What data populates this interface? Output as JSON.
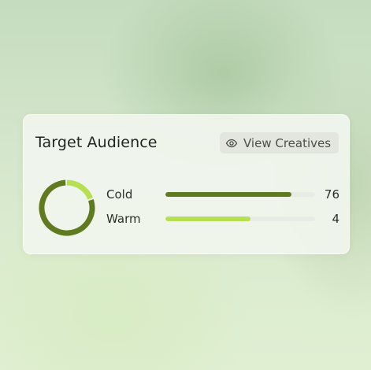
{
  "card": {
    "title": "Target Audience",
    "view_button": {
      "label": "View Creatives",
      "icon": "eye-icon"
    }
  },
  "colors": {
    "cold": "#5f7a1f",
    "warm": "#b7df52",
    "track": "#e9ece6"
  },
  "segments": [
    {
      "name": "Cold",
      "value": "76",
      "fill_fraction": 0.84
    },
    {
      "name": "Warm",
      "value": "4",
      "fill_fraction": 0.57
    }
  ],
  "donut": {
    "cold_fraction": 0.8,
    "warm_fraction": 0.2
  }
}
